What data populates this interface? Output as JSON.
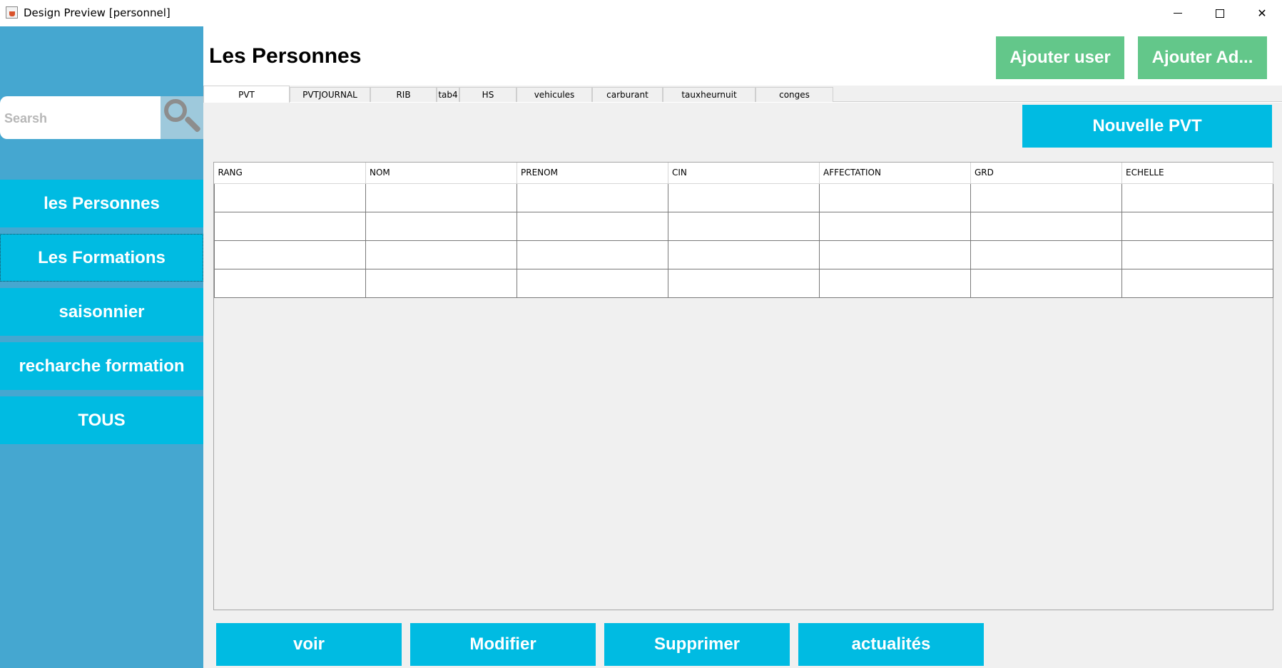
{
  "window": {
    "title": "Design Preview [personnel]",
    "controls": {
      "minimize": "minimize",
      "maximize": "maximize",
      "close": "✕"
    }
  },
  "sidebar": {
    "search": {
      "placeholder": "Searsh",
      "icon": "search-icon"
    },
    "items": [
      {
        "label": "les Personnes"
      },
      {
        "label": "Les Formations"
      },
      {
        "label": "saisonnier"
      },
      {
        "label": "recharche formation"
      },
      {
        "label": "TOUS"
      }
    ]
  },
  "header": {
    "title": "Les Personnes",
    "buttons": {
      "add_user": "Ajouter user",
      "add_admin": "Ajouter Ad..."
    }
  },
  "tabs": [
    {
      "label": "PVT",
      "active": true
    },
    {
      "label": "PVTJOURNAL"
    },
    {
      "label": "RIB"
    },
    {
      "label": "tab4"
    },
    {
      "label": "HS"
    },
    {
      "label": "vehicules"
    },
    {
      "label": "carburant"
    },
    {
      "label": "tauxheurnuit"
    },
    {
      "label": "conges"
    }
  ],
  "main": {
    "new_button": "Nouvelle PVT",
    "table": {
      "columns": [
        "RANG",
        "NOM",
        "PRENOM",
        "CIN",
        "AFFECTATION",
        "GRD",
        "ECHELLE"
      ],
      "rows": [
        [
          "",
          "",
          "",
          "",
          "",
          "",
          ""
        ],
        [
          "",
          "",
          "",
          "",
          "",
          "",
          ""
        ],
        [
          "",
          "",
          "",
          "",
          "",
          "",
          ""
        ],
        [
          "",
          "",
          "",
          "",
          "",
          "",
          ""
        ]
      ]
    },
    "actions": {
      "view": "voir",
      "edit": "Modifier",
      "delete": "Supprimer",
      "refresh": "actualités"
    }
  },
  "colors": {
    "sidebar_bg": "#45a7d0",
    "accent": "#00bbe2",
    "green": "#63c78a",
    "panel_bg": "#f0f0f0"
  }
}
